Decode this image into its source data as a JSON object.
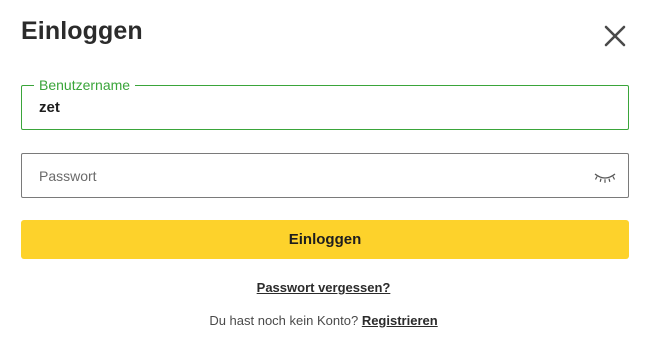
{
  "dialog": {
    "title": "Einloggen",
    "close_icon": "close-icon"
  },
  "username": {
    "label": "Benutzername",
    "value": "zet",
    "accent_color": "#3aa53a"
  },
  "password": {
    "placeholder": "Passwort",
    "visibility_icon": "eye-closed-icon"
  },
  "submit": {
    "label": "Einloggen",
    "color": "#fdd22b"
  },
  "forgot_password": {
    "label": "Passwort vergessen?"
  },
  "register": {
    "prompt": "Du hast noch kein Konto?",
    "link_label": "Registrieren"
  }
}
